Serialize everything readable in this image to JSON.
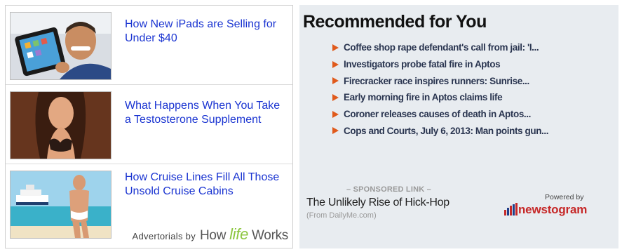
{
  "advertorials": {
    "items": [
      {
        "title": "How New iPads are Selling for Under $40"
      },
      {
        "title": "What Happens When You Take a Testosterone Supplement"
      },
      {
        "title": "How Cruise Lines Fill All Those Unsold Cruise Cabins"
      }
    ],
    "credit_prefix": "Advertorials by",
    "credit_brand_pre": "How ",
    "credit_brand_life": "life",
    "credit_brand_post": " Works"
  },
  "recommended": {
    "title": "Recommended for You",
    "items": [
      "Coffee shop rape defendant's call from jail: 'I...",
      "Investigators probe fatal fire in Aptos",
      "Firecracker race inspires runners: Sunrise...",
      "Early morning fire in Aptos claims life",
      "Coroner releases causes of death in Aptos...",
      "Cops and Courts, July 6, 2013: Man points gun..."
    ],
    "sponsor_label": "– SPONSORED LINK –",
    "sponsor_link": "The Unlikely Rise of Hick-Hop",
    "sponsor_source": "(From DailyMe.com)",
    "powered_by": "Powered by",
    "powered_brand": "newstogram"
  },
  "colors": {
    "link_blue": "#1a34d1",
    "arrow_orange": "#e05a1c",
    "panel_bg": "#e8ecf0",
    "brand_red": "#c62828",
    "life_green": "#8cc63f"
  }
}
